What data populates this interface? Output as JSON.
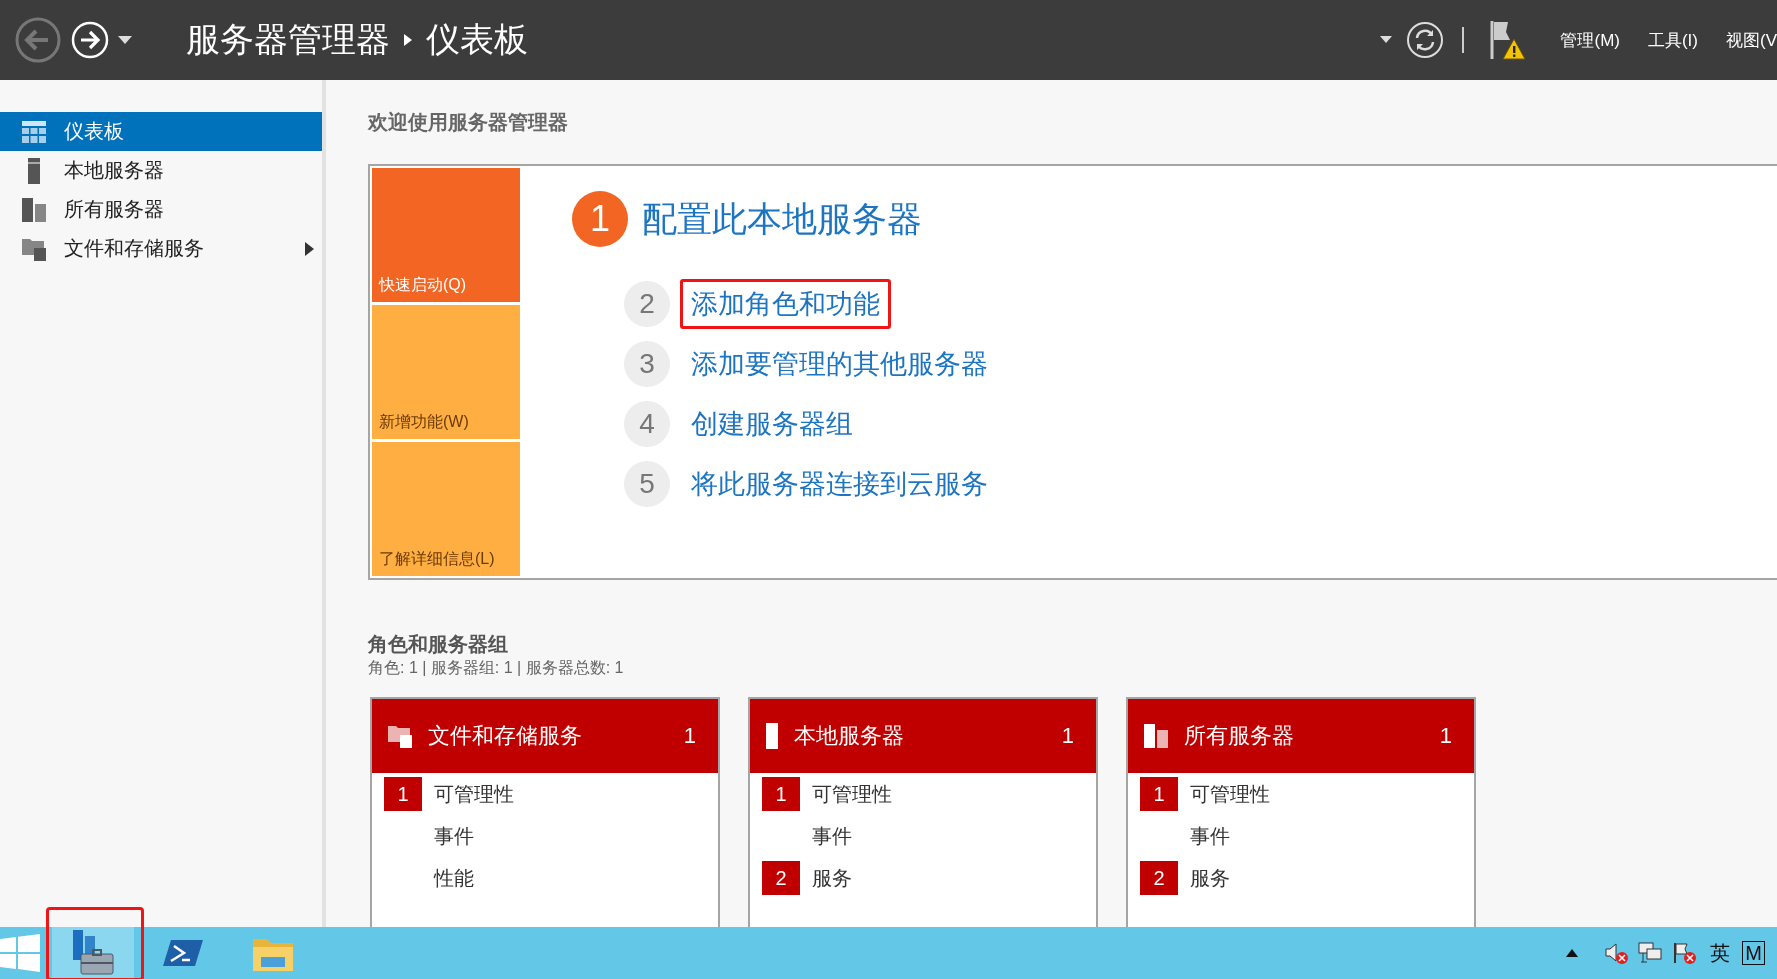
{
  "title_bar": {
    "breadcrumb": [
      "服务器管理器",
      "仪表板"
    ],
    "menus": [
      "管理(M)",
      "工具(I)",
      "视图(V"
    ]
  },
  "sidebar": {
    "items": [
      {
        "label": "仪表板",
        "kind": "dashboard",
        "selected": true,
        "expandable": false
      },
      {
        "label": "本地服务器",
        "kind": "local",
        "selected": false,
        "expandable": false
      },
      {
        "label": "所有服务器",
        "kind": "all",
        "selected": false,
        "expandable": false
      },
      {
        "label": "文件和存储服务",
        "kind": "file",
        "selected": false,
        "expandable": true
      }
    ]
  },
  "welcome": {
    "heading": "欢迎使用服务器管理器",
    "tiles": [
      {
        "label": "快速启动(Q)",
        "selected": true
      },
      {
        "label": "新增功能(W)",
        "selected": false
      },
      {
        "label": "了解详细信息(L)",
        "selected": false
      }
    ],
    "steps": [
      {
        "kind": "primary",
        "number": "1",
        "label": "配置此本地服务器",
        "highlighted": false
      },
      {
        "kind": "secondary",
        "number": "2",
        "label": "添加角色和功能",
        "highlighted": true
      },
      {
        "kind": "secondary",
        "number": "3",
        "label": "添加要管理的其他服务器",
        "highlighted": false
      },
      {
        "kind": "secondary",
        "number": "4",
        "label": "创建服务器组",
        "highlighted": false
      },
      {
        "kind": "secondary",
        "number": "5",
        "label": "将此服务器连接到云服务",
        "highlighted": false
      }
    ]
  },
  "roles": {
    "heading": "角色和服务器组",
    "summary": "角色: 1 | 服务器组: 1 | 服务器总数: 1",
    "cards": [
      {
        "kind": "file",
        "title": "文件和存储服务",
        "count": "1",
        "rows": [
          {
            "label": "可管理性",
            "count": "1"
          },
          {
            "label": "事件"
          },
          {
            "label": "性能"
          }
        ]
      },
      {
        "kind": "local",
        "title": "本地服务器",
        "count": "1",
        "rows": [
          {
            "label": "可管理性",
            "count": "1"
          },
          {
            "label": "事件"
          },
          {
            "label": "服务",
            "count": "2"
          }
        ]
      },
      {
        "kind": "all",
        "title": "所有服务器",
        "count": "1",
        "rows": [
          {
            "label": "可管理性",
            "count": "1"
          },
          {
            "label": "事件"
          },
          {
            "label": "服务",
            "count": "2"
          }
        ]
      }
    ]
  },
  "taskbar": {
    "apps": [
      {
        "kind": "server-manager",
        "active": true,
        "highlighted": true
      },
      {
        "kind": "powershell",
        "active": false,
        "highlighted": false
      },
      {
        "kind": "explorer",
        "active": false,
        "highlighted": false
      }
    ],
    "tray": {
      "language": "英",
      "ime": "M"
    }
  }
}
